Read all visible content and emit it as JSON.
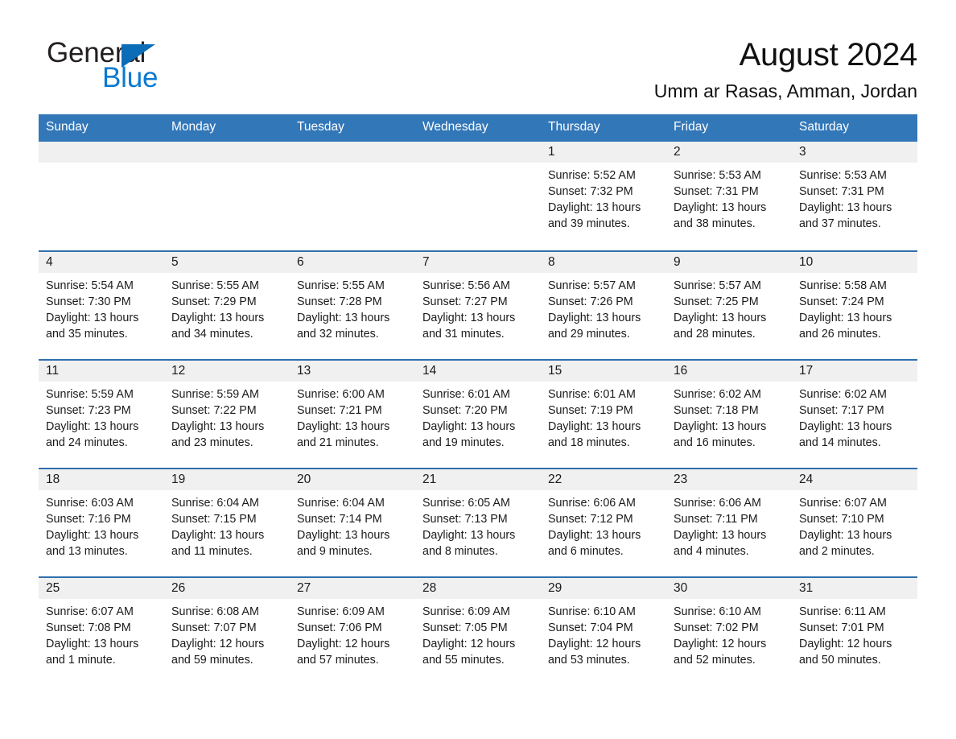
{
  "brand": {
    "name_part1": "General",
    "name_part2": "Blue",
    "triangle_color": "#0b6cb7",
    "blue_color": "#0b7ad1"
  },
  "header": {
    "title": "August 2024",
    "subtitle": "Umm ar Rasas, Amman, Jordan"
  },
  "theme": {
    "header_bg": "#3277b8",
    "row_divider": "#2f6fae",
    "date_band_bg": "#f0f0f0",
    "text": "#1a1a1a"
  },
  "weekdays": [
    "Sunday",
    "Monday",
    "Tuesday",
    "Wednesday",
    "Thursday",
    "Friday",
    "Saturday"
  ],
  "weeks": [
    [
      {
        "day": "",
        "sunrise": "",
        "sunset": "",
        "daylight1": "",
        "daylight2": "",
        "empty": true
      },
      {
        "day": "",
        "sunrise": "",
        "sunset": "",
        "daylight1": "",
        "daylight2": "",
        "empty": true
      },
      {
        "day": "",
        "sunrise": "",
        "sunset": "",
        "daylight1": "",
        "daylight2": "",
        "empty": true
      },
      {
        "day": "",
        "sunrise": "",
        "sunset": "",
        "daylight1": "",
        "daylight2": "",
        "empty": true
      },
      {
        "day": "1",
        "sunrise": "Sunrise: 5:52 AM",
        "sunset": "Sunset: 7:32 PM",
        "daylight1": "Daylight: 13 hours",
        "daylight2": "and 39 minutes."
      },
      {
        "day": "2",
        "sunrise": "Sunrise: 5:53 AM",
        "sunset": "Sunset: 7:31 PM",
        "daylight1": "Daylight: 13 hours",
        "daylight2": "and 38 minutes."
      },
      {
        "day": "3",
        "sunrise": "Sunrise: 5:53 AM",
        "sunset": "Sunset: 7:31 PM",
        "daylight1": "Daylight: 13 hours",
        "daylight2": "and 37 minutes."
      }
    ],
    [
      {
        "day": "4",
        "sunrise": "Sunrise: 5:54 AM",
        "sunset": "Sunset: 7:30 PM",
        "daylight1": "Daylight: 13 hours",
        "daylight2": "and 35 minutes."
      },
      {
        "day": "5",
        "sunrise": "Sunrise: 5:55 AM",
        "sunset": "Sunset: 7:29 PM",
        "daylight1": "Daylight: 13 hours",
        "daylight2": "and 34 minutes."
      },
      {
        "day": "6",
        "sunrise": "Sunrise: 5:55 AM",
        "sunset": "Sunset: 7:28 PM",
        "daylight1": "Daylight: 13 hours",
        "daylight2": "and 32 minutes."
      },
      {
        "day": "7",
        "sunrise": "Sunrise: 5:56 AM",
        "sunset": "Sunset: 7:27 PM",
        "daylight1": "Daylight: 13 hours",
        "daylight2": "and 31 minutes."
      },
      {
        "day": "8",
        "sunrise": "Sunrise: 5:57 AM",
        "sunset": "Sunset: 7:26 PM",
        "daylight1": "Daylight: 13 hours",
        "daylight2": "and 29 minutes."
      },
      {
        "day": "9",
        "sunrise": "Sunrise: 5:57 AM",
        "sunset": "Sunset: 7:25 PM",
        "daylight1": "Daylight: 13 hours",
        "daylight2": "and 28 minutes."
      },
      {
        "day": "10",
        "sunrise": "Sunrise: 5:58 AM",
        "sunset": "Sunset: 7:24 PM",
        "daylight1": "Daylight: 13 hours",
        "daylight2": "and 26 minutes."
      }
    ],
    [
      {
        "day": "11",
        "sunrise": "Sunrise: 5:59 AM",
        "sunset": "Sunset: 7:23 PM",
        "daylight1": "Daylight: 13 hours",
        "daylight2": "and 24 minutes."
      },
      {
        "day": "12",
        "sunrise": "Sunrise: 5:59 AM",
        "sunset": "Sunset: 7:22 PM",
        "daylight1": "Daylight: 13 hours",
        "daylight2": "and 23 minutes."
      },
      {
        "day": "13",
        "sunrise": "Sunrise: 6:00 AM",
        "sunset": "Sunset: 7:21 PM",
        "daylight1": "Daylight: 13 hours",
        "daylight2": "and 21 minutes."
      },
      {
        "day": "14",
        "sunrise": "Sunrise: 6:01 AM",
        "sunset": "Sunset: 7:20 PM",
        "daylight1": "Daylight: 13 hours",
        "daylight2": "and 19 minutes."
      },
      {
        "day": "15",
        "sunrise": "Sunrise: 6:01 AM",
        "sunset": "Sunset: 7:19 PM",
        "daylight1": "Daylight: 13 hours",
        "daylight2": "and 18 minutes."
      },
      {
        "day": "16",
        "sunrise": "Sunrise: 6:02 AM",
        "sunset": "Sunset: 7:18 PM",
        "daylight1": "Daylight: 13 hours",
        "daylight2": "and 16 minutes."
      },
      {
        "day": "17",
        "sunrise": "Sunrise: 6:02 AM",
        "sunset": "Sunset: 7:17 PM",
        "daylight1": "Daylight: 13 hours",
        "daylight2": "and 14 minutes."
      }
    ],
    [
      {
        "day": "18",
        "sunrise": "Sunrise: 6:03 AM",
        "sunset": "Sunset: 7:16 PM",
        "daylight1": "Daylight: 13 hours",
        "daylight2": "and 13 minutes."
      },
      {
        "day": "19",
        "sunrise": "Sunrise: 6:04 AM",
        "sunset": "Sunset: 7:15 PM",
        "daylight1": "Daylight: 13 hours",
        "daylight2": "and 11 minutes."
      },
      {
        "day": "20",
        "sunrise": "Sunrise: 6:04 AM",
        "sunset": "Sunset: 7:14 PM",
        "daylight1": "Daylight: 13 hours",
        "daylight2": "and 9 minutes."
      },
      {
        "day": "21",
        "sunrise": "Sunrise: 6:05 AM",
        "sunset": "Sunset: 7:13 PM",
        "daylight1": "Daylight: 13 hours",
        "daylight2": "and 8 minutes."
      },
      {
        "day": "22",
        "sunrise": "Sunrise: 6:06 AM",
        "sunset": "Sunset: 7:12 PM",
        "daylight1": "Daylight: 13 hours",
        "daylight2": "and 6 minutes."
      },
      {
        "day": "23",
        "sunrise": "Sunrise: 6:06 AM",
        "sunset": "Sunset: 7:11 PM",
        "daylight1": "Daylight: 13 hours",
        "daylight2": "and 4 minutes."
      },
      {
        "day": "24",
        "sunrise": "Sunrise: 6:07 AM",
        "sunset": "Sunset: 7:10 PM",
        "daylight1": "Daylight: 13 hours",
        "daylight2": "and 2 minutes."
      }
    ],
    [
      {
        "day": "25",
        "sunrise": "Sunrise: 6:07 AM",
        "sunset": "Sunset: 7:08 PM",
        "daylight1": "Daylight: 13 hours",
        "daylight2": "and 1 minute."
      },
      {
        "day": "26",
        "sunrise": "Sunrise: 6:08 AM",
        "sunset": "Sunset: 7:07 PM",
        "daylight1": "Daylight: 12 hours",
        "daylight2": "and 59 minutes."
      },
      {
        "day": "27",
        "sunrise": "Sunrise: 6:09 AM",
        "sunset": "Sunset: 7:06 PM",
        "daylight1": "Daylight: 12 hours",
        "daylight2": "and 57 minutes."
      },
      {
        "day": "28",
        "sunrise": "Sunrise: 6:09 AM",
        "sunset": "Sunset: 7:05 PM",
        "daylight1": "Daylight: 12 hours",
        "daylight2": "and 55 minutes."
      },
      {
        "day": "29",
        "sunrise": "Sunrise: 6:10 AM",
        "sunset": "Sunset: 7:04 PM",
        "daylight1": "Daylight: 12 hours",
        "daylight2": "and 53 minutes."
      },
      {
        "day": "30",
        "sunrise": "Sunrise: 6:10 AM",
        "sunset": "Sunset: 7:02 PM",
        "daylight1": "Daylight: 12 hours",
        "daylight2": "and 52 minutes."
      },
      {
        "day": "31",
        "sunrise": "Sunrise: 6:11 AM",
        "sunset": "Sunset: 7:01 PM",
        "daylight1": "Daylight: 12 hours",
        "daylight2": "and 50 minutes."
      }
    ]
  ]
}
